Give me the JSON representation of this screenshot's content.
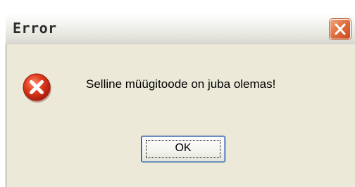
{
  "dialog": {
    "title": "Error",
    "message": "Selline müügitoode on juba olemas!",
    "icon": "error-icon",
    "ok_label": "OK",
    "close_icon": "close-icon"
  },
  "colors": {
    "client_background": "#ece9d8",
    "close_button": "#e27342",
    "error_icon": "#d42d13"
  }
}
